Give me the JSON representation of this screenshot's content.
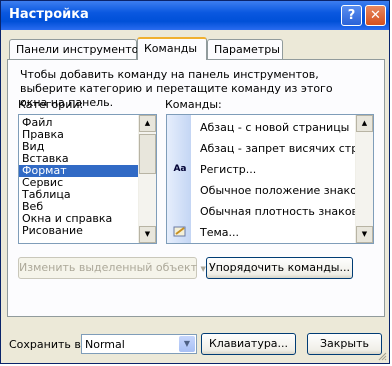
{
  "window": {
    "title": "Настройка",
    "help_label": "?",
    "close_label": "✕"
  },
  "tabs": [
    {
      "label": "Панели инструментов",
      "active": false
    },
    {
      "label": "Команды",
      "active": true
    },
    {
      "label": "Параметры",
      "active": false
    }
  ],
  "description": "Чтобы добавить команду на панель инструментов, выберите категорию и перетащите команду из этого окна на панель.",
  "categories": {
    "label": "Категории:",
    "items": [
      "Файл",
      "Правка",
      "Вид",
      "Вставка",
      "Формат",
      "Сервис",
      "Таблица",
      "Веб",
      "Окна и справка",
      "Рисование"
    ],
    "selected": "Формат"
  },
  "commands": {
    "label": "Команды:",
    "items": [
      {
        "label": "Абзац - с новой страницы",
        "icon": ""
      },
      {
        "label": "Абзац - запрет висячих строк",
        "icon": ""
      },
      {
        "label": "Регистр...",
        "icon": "Aa"
      },
      {
        "label": "Обычное положение знаков",
        "icon": ""
      },
      {
        "label": "Обычная плотность знаков",
        "icon": ""
      },
      {
        "label": "Тема...",
        "icon": "theme-icon"
      }
    ]
  },
  "buttons": {
    "modify_selection": "Изменить выделенный объект",
    "rearrange": "Упорядочить команды...",
    "keyboard": "Клавиатура...",
    "close": "Закрыть"
  },
  "save_in": {
    "label": "Сохранить в:",
    "value": "Normal"
  }
}
